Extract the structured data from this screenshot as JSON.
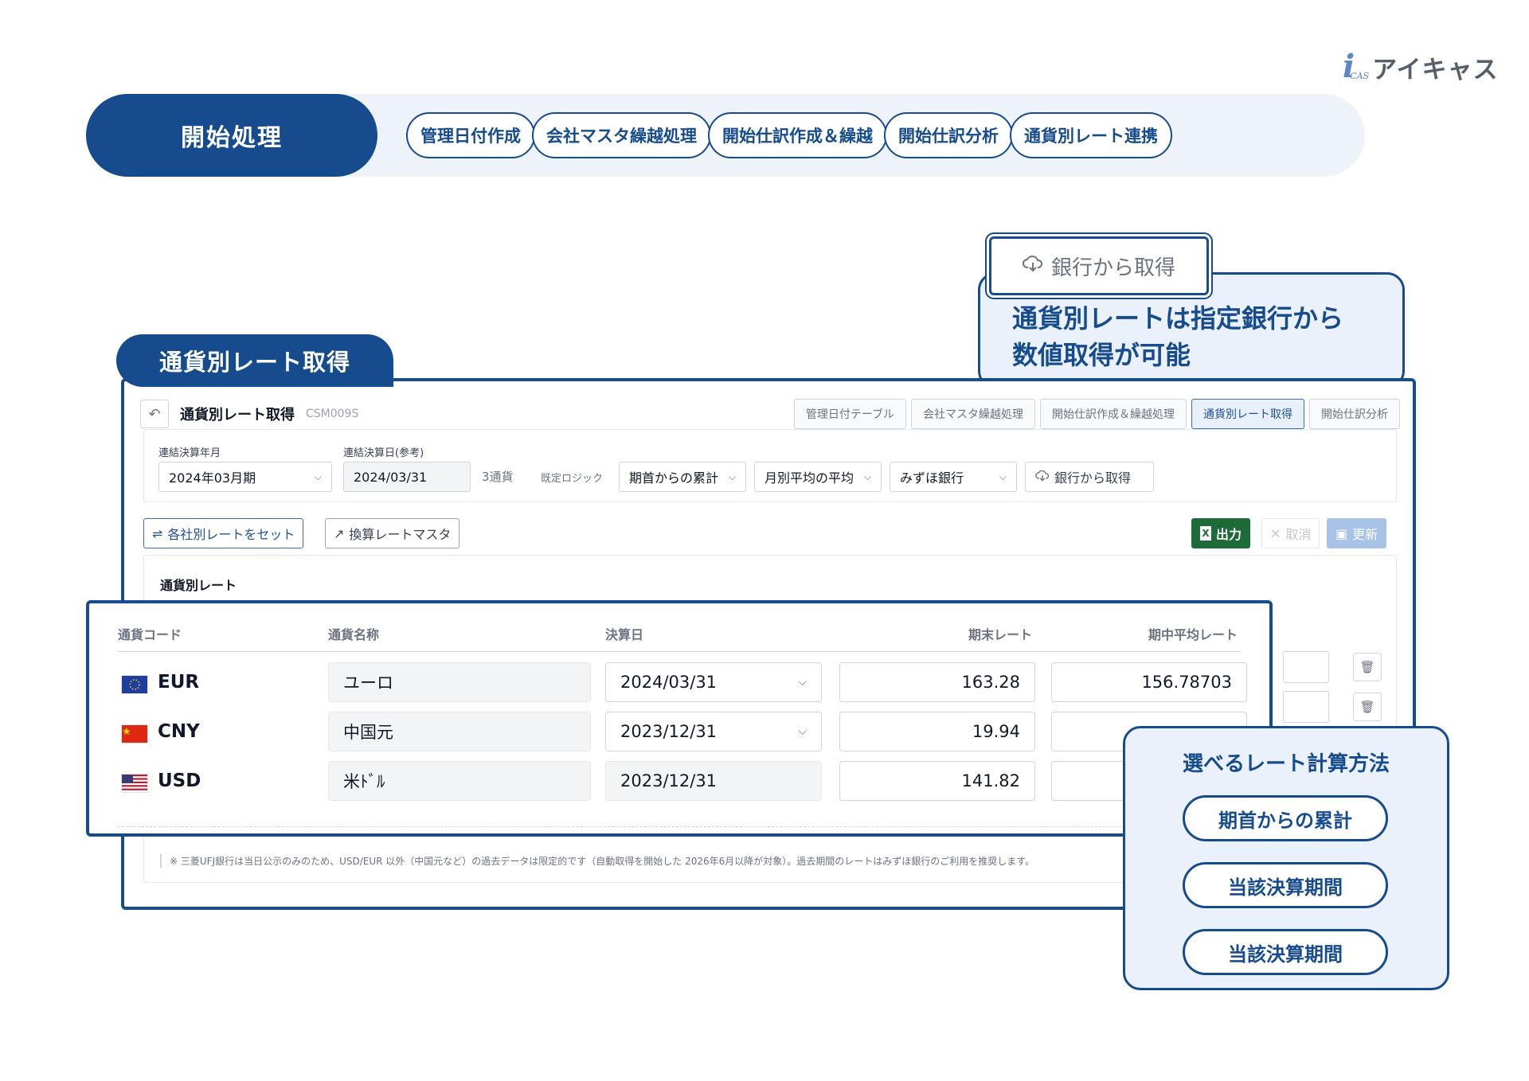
{
  "brand": {
    "mark": "i",
    "sub": "CAS",
    "name": "アイキャス"
  },
  "process": {
    "current": "開始処理",
    "steps": [
      "管理日付作成",
      "会社マスタ繰越処理",
      "開始仕訳作成＆繰越",
      "開始仕訳分析",
      "通貨別レート連携"
    ]
  },
  "callout_bank": {
    "button_label": "銀行から取得",
    "icon": "cloud-download-icon",
    "line1": "通貨別レートは指定銀行から",
    "line2": "数値取得が可能"
  },
  "section_label": "通貨別レート取得",
  "window": {
    "title": "通貨別レート取得",
    "code": "CSM009S",
    "tabs": [
      {
        "label": "管理日付テーブル",
        "active": false
      },
      {
        "label": "会社マスタ繰越処理",
        "active": false
      },
      {
        "label": "開始仕訳作成＆繰越処理",
        "active": false
      },
      {
        "label": "通貨別レート取得",
        "active": true
      },
      {
        "label": "開始仕訳分析",
        "active": false
      }
    ],
    "filters": {
      "period_label": "連結決算年月",
      "period_value": "2024年03月期",
      "date_label": "連結決算日(参考)",
      "date_value": "2024/03/31",
      "currency_count": "3通貨",
      "logic_label": "既定ロジック",
      "logic_value": "期首からの累計",
      "avg_value": "月別平均の平均",
      "bank_value": "みずほ銀行",
      "fetch_button": "銀行から取得"
    },
    "toolbar": {
      "set_rates": "各社別レートをセット",
      "rate_master": "換算レートマスタ",
      "export": "出力",
      "cancel": "取消",
      "update": "更新"
    },
    "card_title": "通貨別レート",
    "note": "※ 三菱UFJ銀行は当日公示のみのため、USD/EUR 以外（中国元など）の過去データは限定的です（自動取得を開始した 2026年6月以降が対象）。過去期間のレートはみずほ銀行のご利用を推奨します。"
  },
  "rate_table": {
    "columns": [
      "通貨コード",
      "通貨名称",
      "決算日",
      "期末レート",
      "期中平均レート"
    ],
    "rows": [
      {
        "code": "EUR",
        "name": "ユーロ",
        "date": "2024/03/31",
        "date_select": true,
        "closing": "163.28",
        "average": "156.78703"
      },
      {
        "code": "CNY",
        "name": "中国元",
        "date": "2023/12/31",
        "date_select": true,
        "closing": "19.94",
        "average": ""
      },
      {
        "code": "USD",
        "name": "米ﾄﾞﾙ",
        "date": "2023/12/31",
        "date_select": false,
        "closing": "141.82",
        "average": ""
      }
    ]
  },
  "methods": {
    "title": "選べるレート計算方法",
    "items": [
      "期首からの累計",
      "当該決算期間",
      "当該決算期間"
    ]
  },
  "colors": {
    "brand": "#164b8e",
    "callout_bg": "#eaf1fa",
    "excel": "#1e6b3a"
  }
}
